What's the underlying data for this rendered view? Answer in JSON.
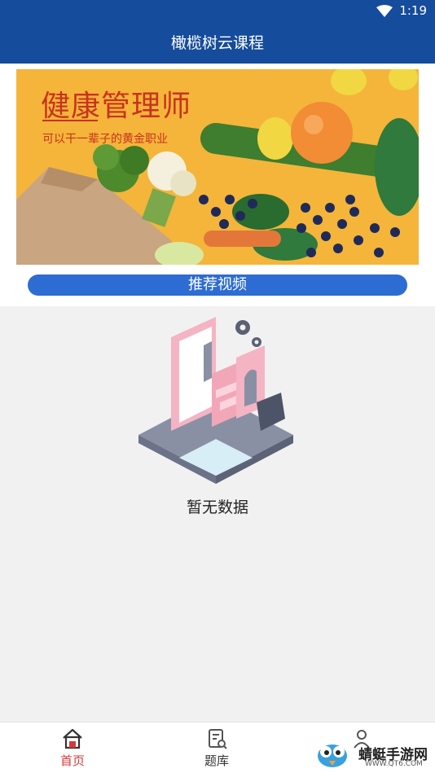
{
  "status_bar": {
    "time": "1:19"
  },
  "header": {
    "title": "橄榄树云课程"
  },
  "banner": {
    "title": "健康管理师",
    "subtitle": "可以干一辈子的黄金职业"
  },
  "section": {
    "label": "推荐视频"
  },
  "empty_state": {
    "text": "暂无数据"
  },
  "bottom_nav": {
    "items": [
      {
        "label": "首页",
        "icon": "home-icon",
        "active": true
      },
      {
        "label": "题库",
        "icon": "question-bank-icon",
        "active": false
      },
      {
        "label": "",
        "icon": "profile-icon",
        "active": false
      }
    ]
  },
  "watermark": {
    "text": "蜻蜓手游网",
    "url": "WWW.QT6.COM"
  },
  "colors": {
    "header_bg": "#154c9b",
    "section_button": "#2d6cd2",
    "active_nav": "#d8383a",
    "banner_bg": "#f4b53a"
  }
}
